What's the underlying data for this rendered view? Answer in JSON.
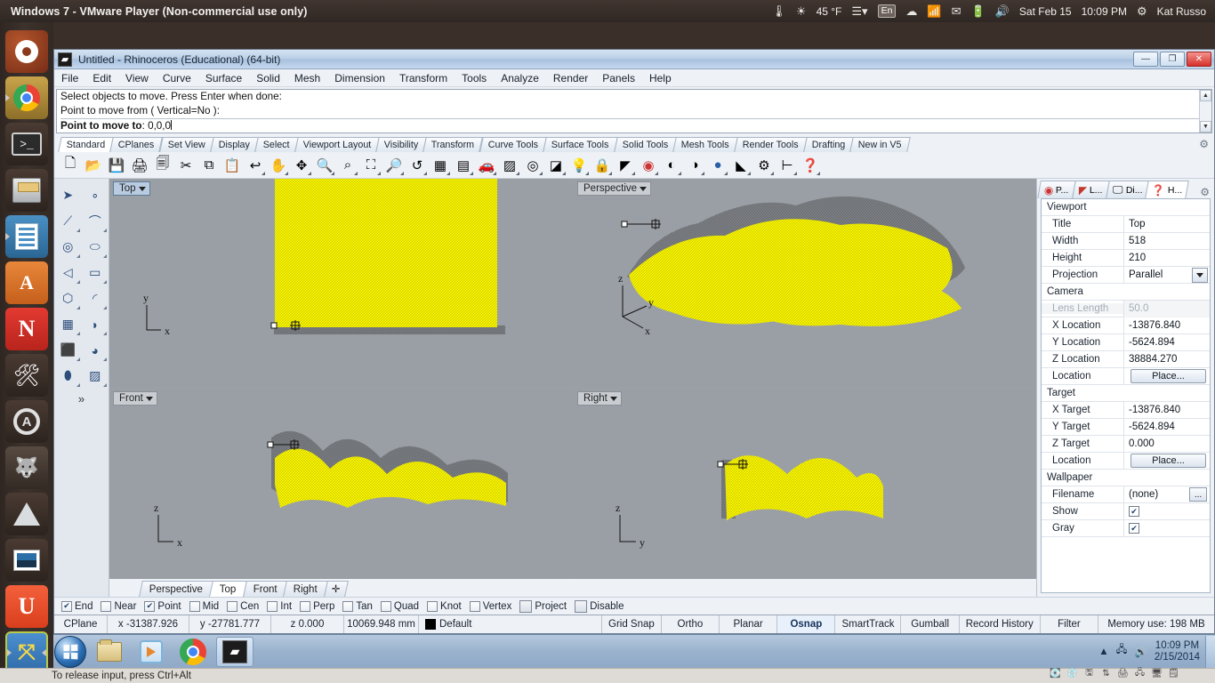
{
  "ubuntu_topbar": {
    "vm_title": "Windows 7 - VMware Player (Non-commercial use only)",
    "temperature": "45 °F",
    "keyboard_layout": "En",
    "date": "Sat Feb 15",
    "time": "10:09 PM",
    "user": "Kat Russo",
    "icons": [
      "thermometer-icon",
      "weather-icon",
      "menu-icon",
      "dropbox-icon",
      "wifi-icon",
      "mail-icon",
      "battery-icon",
      "volume-icon",
      "gear-icon"
    ]
  },
  "launcher": {
    "items": [
      {
        "name": "ubuntu-dash",
        "label": "Ubuntu Dash"
      },
      {
        "name": "google-chrome",
        "label": "Google Chrome"
      },
      {
        "name": "terminal",
        "label": "Terminal"
      },
      {
        "name": "files",
        "label": "Files"
      },
      {
        "name": "libreoffice-writer",
        "label": "LibreOffice Writer"
      },
      {
        "name": "ubuntu-software",
        "label": "Ubuntu Software Center"
      },
      {
        "name": "netflix",
        "label": "Netflix"
      },
      {
        "name": "system-settings",
        "label": "System Settings"
      },
      {
        "name": "software-updater",
        "label": "Software Updater"
      },
      {
        "name": "gimp",
        "label": "GIMP"
      },
      {
        "name": "inkscape",
        "label": "Inkscape"
      },
      {
        "name": "shotwell",
        "label": "Shotwell"
      },
      {
        "name": "ubuntu-one",
        "label": "Ubuntu One"
      },
      {
        "name": "vmware-player",
        "label": "VMware Player"
      }
    ]
  },
  "rhino": {
    "window_title": "Untitled - Rhinoceros (Educational) (64-bit)",
    "window_buttons": {
      "minimize": "—",
      "maximize": "❐",
      "close": "✕"
    },
    "menu": [
      "File",
      "Edit",
      "View",
      "Curve",
      "Surface",
      "Solid",
      "Mesh",
      "Dimension",
      "Transform",
      "Tools",
      "Analyze",
      "Render",
      "Panels",
      "Help"
    ],
    "command_history": [
      "Select objects to move. Press Enter when done:",
      "Point to move from ( Vertical=No ):"
    ],
    "command_prompt_label": "Point to move to",
    "command_prompt_value": "0,0,0",
    "toolbar_tabs": [
      "Standard",
      "CPlanes",
      "Set View",
      "Display",
      "Select",
      "Viewport Layout",
      "Visibility",
      "Transform",
      "Curve Tools",
      "Surface Tools",
      "Solid Tools",
      "Mesh Tools",
      "Render Tools",
      "Drafting",
      "New in V5"
    ],
    "active_toolbar_tab": "Standard",
    "toolbar_icons": [
      "new-file-icon",
      "open-folder-icon",
      "save-icon",
      "print-icon",
      "copy-to-clipboard-icon",
      "cut-icon",
      "copy-icon",
      "paste-icon",
      "undo-icon",
      "pan-icon",
      "rotate-view-icon",
      "zoom-in-out-icon",
      "zoom-window-icon",
      "zoom-extents-icon",
      "zoom-selected-icon",
      "zoom-previous-icon",
      "split-viewport-icon",
      "render-icon",
      "car-icon",
      "grid-icon",
      "circle-tool-icon",
      "layout-icon",
      "light-bulb-icon",
      "lock-icon",
      "layers-icon",
      "color-wheel-icon",
      "shaded-sphere-icon",
      "ghosted-sphere-icon",
      "rendered-sphere-icon",
      "isocurve-icon",
      "settings-gear-icon",
      "dimension-icon",
      "help-icon"
    ],
    "sidebar_tools": [
      "select-arrow-icon",
      "point-icon",
      "polyline-icon",
      "curve-icon",
      "circle-icon",
      "ellipse-icon",
      "polygon-icon",
      "rectangle-icon",
      "hexagon-icon",
      "arc-icon",
      "surface-from-points-icon",
      "surface-sweep-icon",
      "box-icon",
      "sphere-icon",
      "cylinder-icon",
      "mesh-plane-icon",
      "more-tools-icon"
    ],
    "viewports": [
      {
        "name": "top",
        "label": "Top",
        "active": true,
        "axes": [
          "y",
          "x"
        ]
      },
      {
        "name": "perspective",
        "label": "Perspective",
        "active": false,
        "axes": [
          "z",
          "y",
          "x"
        ]
      },
      {
        "name": "front",
        "label": "Front",
        "active": false,
        "axes": [
          "z",
          "x"
        ]
      },
      {
        "name": "right",
        "label": "Right",
        "active": false,
        "axes": [
          "z",
          "y"
        ]
      }
    ],
    "viewport_tabs": [
      "Perspective",
      "Top",
      "Front",
      "Right"
    ],
    "active_viewport_tab": "Top",
    "viewport_tab_add": "✛",
    "properties": {
      "tabs": [
        {
          "name": "properties",
          "label": "P...",
          "icon": "color-wheel-icon",
          "active": false
        },
        {
          "name": "layers",
          "label": "L...",
          "icon": "layers-icon",
          "active": false
        },
        {
          "name": "display",
          "label": "Di...",
          "icon": "display-monitor-icon",
          "active": false
        },
        {
          "name": "help",
          "label": "H...",
          "icon": "help-question-icon",
          "active": true
        }
      ],
      "groups": [
        {
          "title": "Viewport",
          "rows": [
            {
              "key": "Title",
              "value": "Top",
              "type": "text"
            },
            {
              "key": "Width",
              "value": "518",
              "type": "text"
            },
            {
              "key": "Height",
              "value": "210",
              "type": "text"
            },
            {
              "key": "Projection",
              "value": "Parallel",
              "type": "dropdown"
            }
          ]
        },
        {
          "title": "Camera",
          "rows": [
            {
              "key": "Lens Length",
              "value": "50.0",
              "type": "disabled"
            },
            {
              "key": "X Location",
              "value": "-13876.840",
              "type": "text"
            },
            {
              "key": "Y Location",
              "value": "-5624.894",
              "type": "text"
            },
            {
              "key": "Z Location",
              "value": "38884.270",
              "type": "text"
            },
            {
              "key": "Location",
              "value": "Place...",
              "type": "button"
            }
          ]
        },
        {
          "title": "Target",
          "rows": [
            {
              "key": "X Target",
              "value": "-13876.840",
              "type": "text"
            },
            {
              "key": "Y Target",
              "value": "-5624.894",
              "type": "text"
            },
            {
              "key": "Z Target",
              "value": "0.000",
              "type": "text"
            },
            {
              "key": "Location",
              "value": "Place...",
              "type": "button"
            }
          ]
        },
        {
          "title": "Wallpaper",
          "rows": [
            {
              "key": "Filename",
              "value": "(none)",
              "type": "ellipsis"
            },
            {
              "key": "Show",
              "value": "",
              "type": "checkbox",
              "checked": true
            },
            {
              "key": "Gray",
              "value": "",
              "type": "checkbox",
              "checked": true
            }
          ]
        }
      ]
    },
    "osnap": [
      {
        "label": "End",
        "checked": true
      },
      {
        "label": "Near",
        "checked": false
      },
      {
        "label": "Point",
        "checked": true
      },
      {
        "label": "Mid",
        "checked": false
      },
      {
        "label": "Cen",
        "checked": false
      },
      {
        "label": "Int",
        "checked": false
      },
      {
        "label": "Perp",
        "checked": false
      },
      {
        "label": "Tan",
        "checked": false
      },
      {
        "label": "Quad",
        "checked": false
      },
      {
        "label": "Knot",
        "checked": false
      },
      {
        "label": "Vertex",
        "checked": false
      },
      {
        "label": "Project",
        "checked": false,
        "big": true
      },
      {
        "label": "Disable",
        "checked": false,
        "big": true
      }
    ],
    "statusbar": {
      "cplane": "CPlane",
      "x": "x -31387.926",
      "y": "y -27781.777",
      "z": "z 0.000",
      "units": "10069.948 mm",
      "layer": "Default",
      "layer_color": "#000000",
      "toggles": [
        {
          "label": "Grid Snap",
          "on": false
        },
        {
          "label": "Ortho",
          "on": false
        },
        {
          "label": "Planar",
          "on": false
        },
        {
          "label": "Osnap",
          "on": true
        },
        {
          "label": "SmartTrack",
          "on": false
        },
        {
          "label": "Gumball",
          "on": false
        },
        {
          "label": "Record History",
          "on": false
        },
        {
          "label": "Filter",
          "on": false
        }
      ],
      "memory": "Memory use: 198 MB"
    }
  },
  "windows_taskbar": {
    "start_label": "Start",
    "items": [
      {
        "name": "windows-explorer",
        "label": "Windows Explorer"
      },
      {
        "name": "windows-media-player",
        "label": "Windows Media Player"
      },
      {
        "name": "google-chrome",
        "label": "Google Chrome"
      },
      {
        "name": "rhinoceros",
        "label": "Rhinoceros",
        "active": true
      }
    ],
    "tray_icons": [
      "show-hidden-icon",
      "network-icon",
      "volume-icon"
    ],
    "time": "10:09 PM",
    "date": "2/15/2014"
  },
  "hintbar": {
    "text": "To release input, press Ctrl+Alt",
    "vm_icons": [
      "harddisk-icon",
      "cd-icon",
      "floppy-icon",
      "network-transfer-icon",
      "printer-icon",
      "usb-icon",
      "display-icon",
      "notes-icon"
    ]
  },
  "colors": {
    "mesh_selected": "#ffff00",
    "mesh_unselected": "#808080",
    "viewport_bg": "#9a9fa5",
    "accent": "#2a6fb5"
  }
}
